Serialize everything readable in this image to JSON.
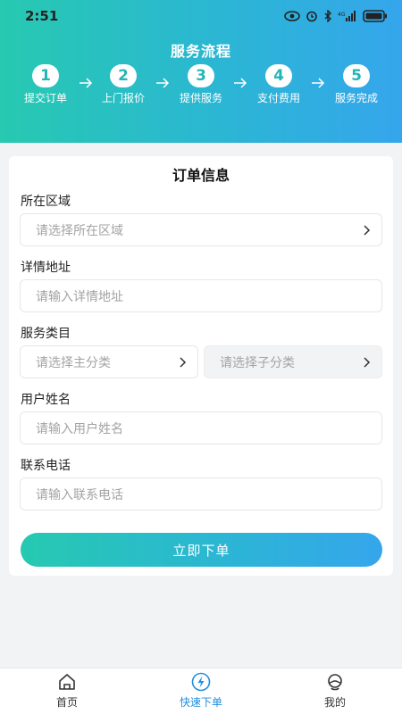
{
  "status_bar": {
    "time": "2:51"
  },
  "header": {
    "title": "服务流程"
  },
  "steps": [
    {
      "num": "1",
      "label": "提交订单"
    },
    {
      "num": "2",
      "label": "上门报价"
    },
    {
      "num": "3",
      "label": "提供服务"
    },
    {
      "num": "4",
      "label": "支付费用"
    },
    {
      "num": "5",
      "label": "服务完成"
    }
  ],
  "form": {
    "title": "订单信息",
    "region": {
      "label": "所在区域",
      "placeholder": "请选择所在区域"
    },
    "address": {
      "label": "详情地址",
      "placeholder": "请输入详情地址"
    },
    "category": {
      "label": "服务类目",
      "main_placeholder": "请选择主分类",
      "sub_placeholder": "请选择子分类"
    },
    "username": {
      "label": "用户姓名",
      "placeholder": "请输入用户姓名"
    },
    "phone": {
      "label": "联系电话",
      "placeholder": "请输入联系电话"
    },
    "submit_label": "立即下单"
  },
  "tabbar": {
    "items": [
      {
        "label": "首页",
        "icon": "home-icon"
      },
      {
        "label": "快速下单",
        "icon": "lightning-icon",
        "active": true
      },
      {
        "label": "我的",
        "icon": "profile-icon"
      }
    ]
  },
  "colors": {
    "accent_start": "#27c9b1",
    "accent_end": "#35a6ec",
    "active_tab": "#1e8fe0"
  }
}
